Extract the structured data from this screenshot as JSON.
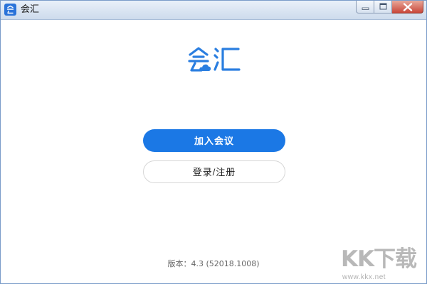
{
  "window": {
    "title": "会汇",
    "title_icon": "app-logo-icon"
  },
  "logo": {
    "text": "会汇",
    "icon": "cloud-icon",
    "color": "#2a7ee0"
  },
  "actions": {
    "join_label": "加入会议",
    "login_label": "登录/注册"
  },
  "footer": {
    "version_text": "版本：4.3 (52018.1008)"
  },
  "watermark": {
    "big": "KK下载",
    "small": "www.kkx.net"
  },
  "colors": {
    "primary": "#1b78e5",
    "close_button": "#c9473a"
  }
}
